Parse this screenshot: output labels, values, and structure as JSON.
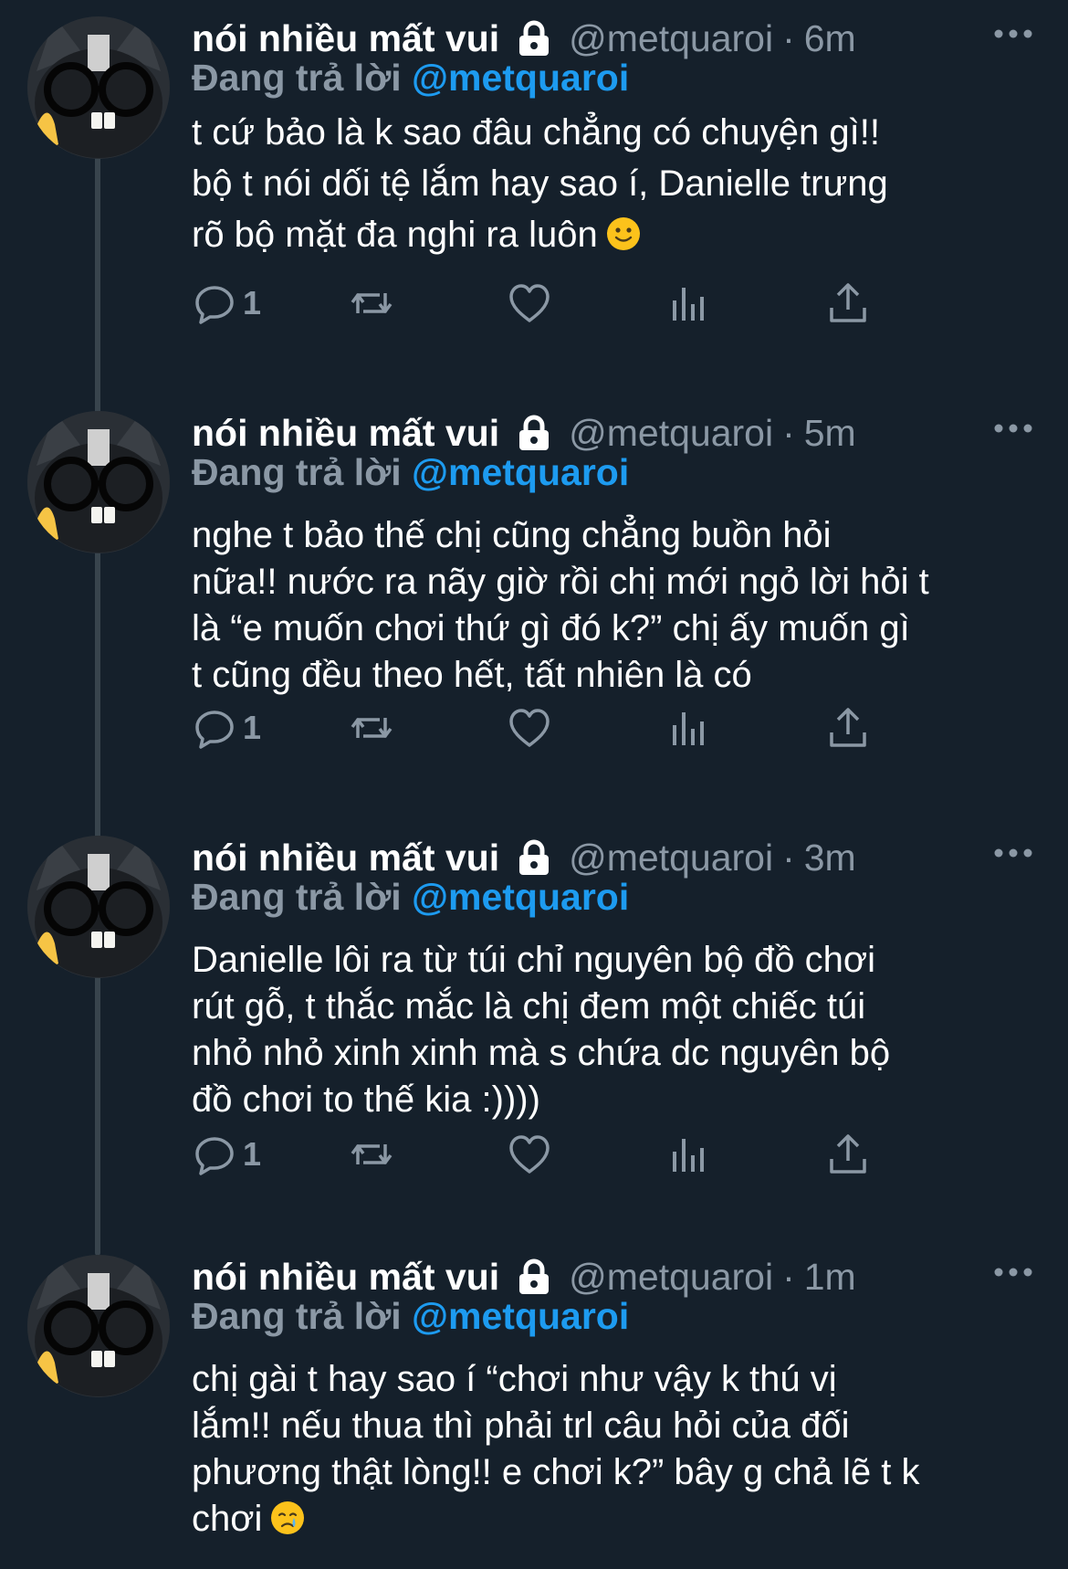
{
  "colors": {
    "background": "#15202b",
    "name": "#ffffff",
    "secondary": "#8b98a5",
    "mention": "#1d9bf0",
    "thread_line": "#38444d"
  },
  "tweets": [
    {
      "name": "nói nhiều mất vui",
      "handle": "@metquaroi",
      "dot": "·",
      "time": "6m",
      "reply_prefix": "Đang trả lời",
      "reply_handle": "@metquaroi",
      "text": "t cứ bảo là k sao đâu chẳng có chuyện gì!!\nbộ t nói dối tệ lắm hay sao í, Danielle trưng\nrõ bộ mặt đa nghi ra luôn",
      "emoji": "slightly-smiling-face",
      "reply_count": "1"
    },
    {
      "name": "nói nhiều mất vui",
      "handle": "@metquaroi",
      "dot": "·",
      "time": "5m",
      "reply_prefix": "Đang trả lời",
      "reply_handle": "@metquaroi",
      "text": "nghe t bảo thế chị cũng chẳng buồn hỏi\nnữa!! nước ra nãy giờ rồi chị mới ngỏ lời hỏi t\nlà “e muốn chơi thứ gì đó k?” chị ấy muốn gì\nt cũng đều theo hết, tất nhiên là có",
      "emoji": "",
      "reply_count": "1"
    },
    {
      "name": "nói nhiều mất vui",
      "handle": "@metquaroi",
      "dot": "·",
      "time": "3m",
      "reply_prefix": "Đang trả lời",
      "reply_handle": "@metquaroi",
      "text": "Danielle lôi ra từ túi chỉ nguyên bộ đồ chơi\nrút gỗ, t thắc mắc là chị đem một chiếc túi\nnhỏ nhỏ xinh xinh mà s chứa dc nguyên bộ\nđồ chơi to thế kia :))))",
      "emoji": "",
      "reply_count": "1"
    },
    {
      "name": "nói nhiều mất vui",
      "handle": "@metquaroi",
      "dot": "·",
      "time": "1m",
      "reply_prefix": "Đang trả lời",
      "reply_handle": "@metquaroi",
      "text": "chị gài t hay sao í “chơi như vậy k thú vị\nlắm!! nếu thua thì phải trl câu hỏi của đối\nphương thật lòng!! e chơi k?” bây g chả lẽ t k\nchơi",
      "emoji": "crying-face",
      "reply_count": ""
    }
  ]
}
